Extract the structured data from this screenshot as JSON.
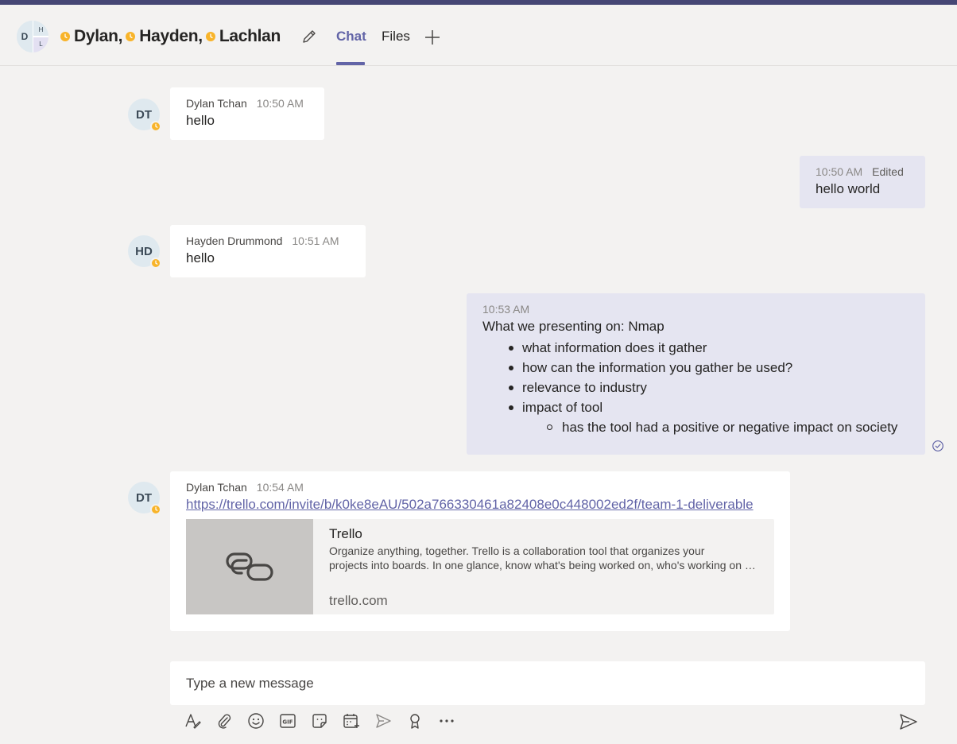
{
  "header": {
    "group_avatar": {
      "left": "D",
      "top_right": "H",
      "bottom_right": "L"
    },
    "participants": [
      "Dylan,",
      "Hayden,",
      "Lachlan"
    ],
    "tabs": [
      {
        "label": "Chat",
        "active": true
      },
      {
        "label": "Files",
        "active": false
      }
    ],
    "status_color": "#f8b42a",
    "accent_color": "#6264a7"
  },
  "messages": [
    {
      "initials": "DT",
      "author": "Dylan Tchan",
      "time": "10:50 AM",
      "text": "hello"
    },
    {
      "time": "10:50 AM",
      "edited": "Edited",
      "text": "hello world"
    },
    {
      "initials": "HD",
      "author": "Hayden Drummond",
      "time": "10:51 AM",
      "text": "hello"
    },
    {
      "time": "10:53 AM",
      "text": "What we presenting on: Nmap",
      "bullets": [
        "what information does it gather",
        "how can the information you gather be used?",
        "relevance to industry",
        "impact of tool"
      ],
      "sub_bullets": [
        "has the tool had a positive or negative impact on society"
      ]
    },
    {
      "initials": "DT",
      "author": "Dylan Tchan",
      "time": "10:54 AM",
      "link": "https://trello.com/invite/b/k0ke8eAU/502a766330461a82408e0c448002ed2f/team-1-deliverable",
      "preview": {
        "title": "Trello",
        "description_line1": "Organize anything, together. Trello is a collaboration tool that organizes your",
        "description_line2": "projects into boards. In one glance, know what's being worked on, who's working on what, and where something is in a process.",
        "domain": "trello.com"
      }
    }
  ],
  "compose": {
    "placeholder": "Type a new message",
    "tools": [
      "format-icon",
      "attach-icon",
      "emoji-icon",
      "gif-icon",
      "sticker-icon",
      "schedule-meeting-icon",
      "stream-icon",
      "praise-icon",
      "more-icon"
    ]
  }
}
